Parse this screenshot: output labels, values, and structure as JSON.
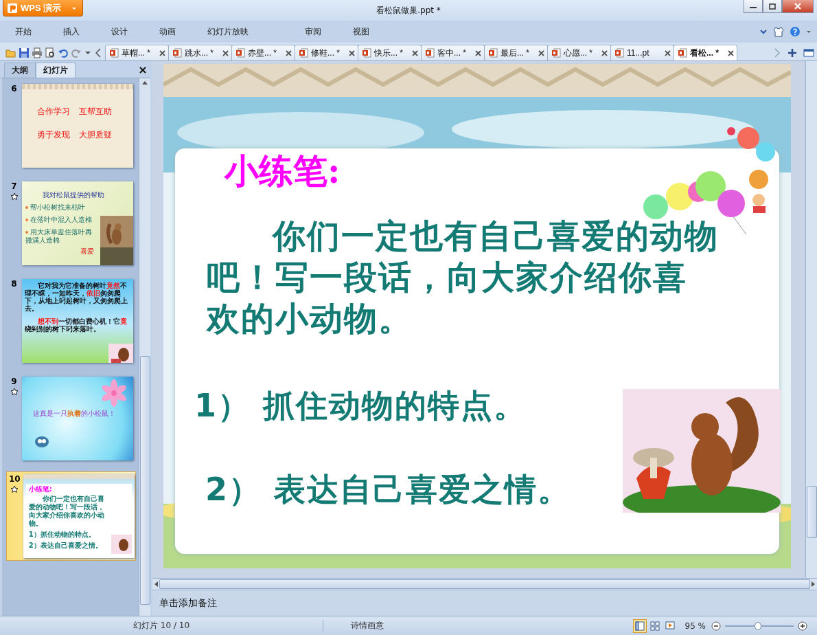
{
  "app_button": {
    "label": "WPS 演示"
  },
  "window": {
    "title": "看松鼠做巢.ppt *"
  },
  "menu": [
    {
      "label": "开始"
    },
    {
      "label": "插入"
    },
    {
      "label": "设计"
    },
    {
      "label": "动画"
    },
    {
      "label": "幻灯片放映"
    },
    {
      "label": "审阅"
    },
    {
      "label": "视图"
    }
  ],
  "doc_tabs": [
    {
      "label": "草帽... *",
      "selected": false
    },
    {
      "label": "跳水... *",
      "selected": false
    },
    {
      "label": "赤壁... *",
      "selected": false
    },
    {
      "label": "修鞋... *",
      "selected": false
    },
    {
      "label": "快乐... *",
      "selected": false
    },
    {
      "label": "客中... *",
      "selected": false
    },
    {
      "label": "最后... *",
      "selected": false
    },
    {
      "label": "心愿... *",
      "selected": false
    },
    {
      "label": "11...pt",
      "selected": false
    },
    {
      "label": "看松... *",
      "selected": true
    }
  ],
  "panel_tabs": [
    {
      "label": "大纲",
      "selected": false
    },
    {
      "label": "幻灯片",
      "selected": true
    }
  ],
  "thumbnails": [
    {
      "number": "6",
      "kind": "phrases",
      "animated": false,
      "selected": false,
      "items": [
        "合作学习",
        "互帮互助",
        "勇于发现",
        "大胆质疑"
      ]
    },
    {
      "number": "7",
      "kind": "bullets",
      "animated": true,
      "selected": false,
      "title": "我对松鼠提供的帮助",
      "items": [
        "帮小松树找来枯叶",
        "在落叶中混入人造棉",
        "用大床单盖住落叶再撒满人造棉"
      ],
      "note": "喜爱"
    },
    {
      "number": "8",
      "kind": "story",
      "animated": false,
      "selected": false,
      "paragraphs": [
        [
          {
            "text": "它对我为它准备的树叶",
            "highlight": false
          },
          {
            "text": "竟然",
            "highlight": true
          },
          {
            "text": "不理不睬，一如昨天，",
            "highlight": false
          },
          {
            "text": "依旧",
            "highlight": true
          },
          {
            "text": "匆匆爬下，从地上叼起树叶，又匆匆爬上去。",
            "highlight": false
          }
        ],
        [
          {
            "text": "想不到",
            "highlight": true
          },
          {
            "text": "一切都白费心机！它",
            "highlight": false
          },
          {
            "text": "竟",
            "highlight": true
          },
          {
            "text": "绕到别的树下叼来落叶。",
            "highlight": false
          }
        ]
      ]
    },
    {
      "number": "9",
      "kind": "frame",
      "animated": true,
      "selected": false,
      "paragraphs": [
        [
          {
            "text": "这真是一只",
            "highlight": false
          },
          {
            "text": "执着",
            "highlight": true
          },
          {
            "text": "的小松鼠！",
            "highlight": false
          }
        ]
      ]
    },
    {
      "number": "10",
      "kind": "exercise",
      "animated": true,
      "selected": true,
      "title": "小练笔:",
      "paragraph": "你们一定也有自己喜爱的动物吧！写一段话，向大家介绍你喜欢的小动物。",
      "items": [
        "1）抓住动物的特点。",
        "2）表达自己喜爱之情。"
      ]
    }
  ],
  "slide": {
    "heading": "小练笔:",
    "paragraph": "你们一定也有自己喜爱的动物吧！写一段话，向大家介绍你喜欢的小动物。",
    "points": [
      "1） 抓住动物的特点。",
      "2） 表达自己喜爱之情。"
    ]
  },
  "notes": {
    "placeholder": "单击添加备注"
  },
  "status_bar": {
    "slide_counter": "幻灯片 10 / 10",
    "theme": "诗情画意",
    "views": [
      {
        "kind": "normal",
        "selected": true
      },
      {
        "kind": "sorter",
        "selected": false
      },
      {
        "kind": "show",
        "selected": false
      }
    ],
    "zoom": "95 %",
    "zoom_slider": {
      "level": 0.48
    }
  }
}
